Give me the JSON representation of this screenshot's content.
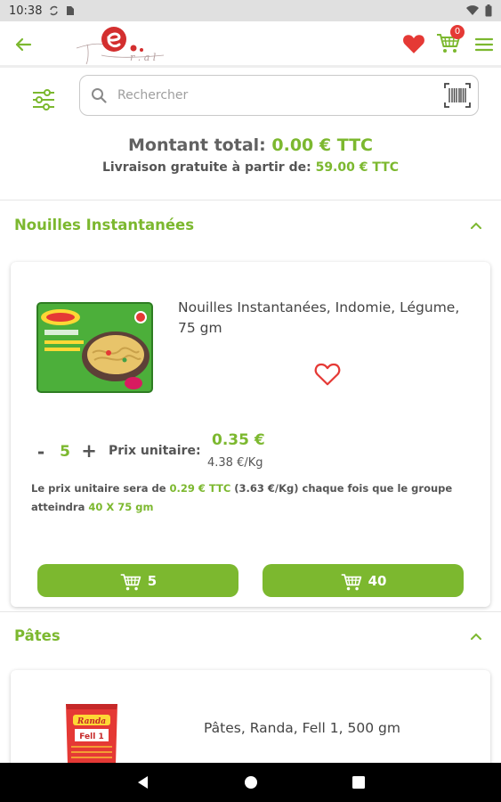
{
  "status_bar": {
    "time": "10:38"
  },
  "app_bar": {
    "cart_count": "0"
  },
  "search": {
    "placeholder": "Rechercher"
  },
  "totals": {
    "total_label": "Montant total: ",
    "total_value": "0.00 € TTC",
    "delivery_label": "Livraison gratuite à partir de: ",
    "delivery_value": "59.00 € TTC"
  },
  "sections": [
    {
      "title": "Nouilles Instantanées",
      "products": [
        {
          "name": "Nouilles Instantanées, Indomie, Légume, 75 gm",
          "quantity": "5",
          "minus": "-",
          "plus": "+",
          "unit_label": "Prix unitaire:",
          "unit_price": "0.35 €",
          "unit_price_kg": "4.38 €/Kg",
          "promo": {
            "prefix": "Le prix unitaire sera de ",
            "price": "0.29 € TTC",
            "middle": " (3.63 €/Kg) chaque fois que le groupe atteindra ",
            "group": "40 X 75 gm"
          },
          "add_buttons": [
            "5",
            "40"
          ]
        }
      ]
    },
    {
      "title": "Pâtes",
      "products": [
        {
          "name": "Pâtes, Randa, Fell 1, 500 gm"
        }
      ]
    }
  ],
  "colors": {
    "accent": "#7cb82f",
    "heart": "#e53935",
    "text": "#444444"
  },
  "icons": [
    "back-arrow-icon",
    "heart-icon",
    "cart-icon",
    "menu-icon",
    "filter-icon",
    "search-icon",
    "barcode-icon",
    "chevron-up-icon"
  ]
}
